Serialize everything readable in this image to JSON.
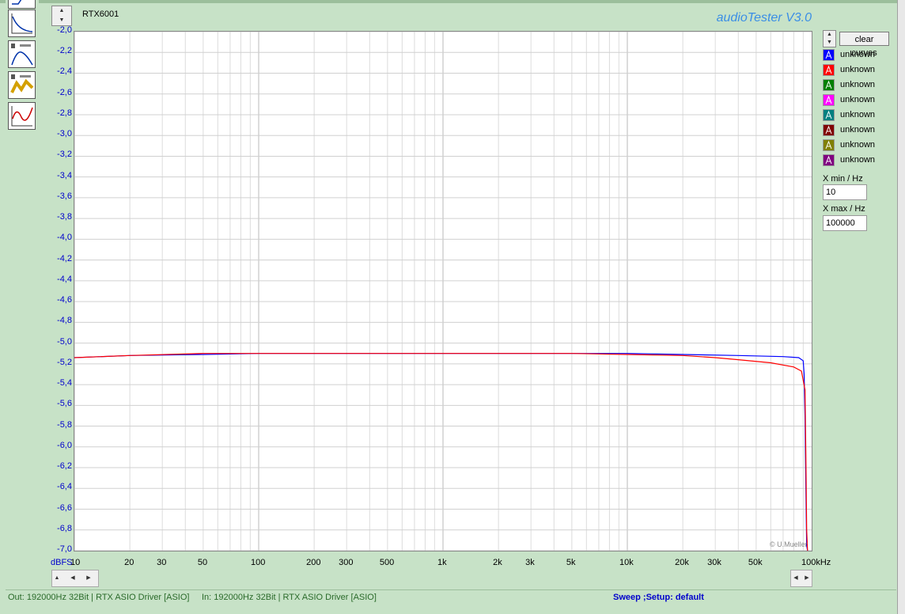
{
  "window": {
    "title": "audioTester  V3.0",
    "chart_name": "RTX6001"
  },
  "toolbar": {
    "tools": [
      "frequency-response-icon",
      "speaker-level-icon",
      "speaker-curve-icon",
      "scope-icon"
    ]
  },
  "legend": {
    "clear_label": "clear curves",
    "items": [
      {
        "label": "unknown",
        "color": "#0000ff"
      },
      {
        "label": "unknown",
        "color": "#ff0000"
      },
      {
        "label": "unknown",
        "color": "#008000"
      },
      {
        "label": "unknown",
        "color": "#ff00ff"
      },
      {
        "label": "unknown",
        "color": "#008080"
      },
      {
        "label": "unknown",
        "color": "#800000"
      },
      {
        "label": "unknown",
        "color": "#808000"
      },
      {
        "label": "unknown",
        "color": "#800080"
      }
    ]
  },
  "xrange": {
    "min_label": "X min / Hz",
    "min_value": "10",
    "max_label": "X max / Hz",
    "max_value": "100000"
  },
  "status": {
    "out": "Out: 192000Hz 32Bit  | RTX ASIO Driver [ASIO]",
    "in": "In: 192000Hz 32Bit  | RTX ASIO Driver [ASIO]",
    "mode": "Sweep ;Setup:  default"
  },
  "copyright": "© U.Mueller",
  "chart_data": {
    "type": "line",
    "title": "RTX6001",
    "ylabel": "dBFS",
    "xscale": "log",
    "xlim": [
      10,
      100000
    ],
    "ylim": [
      -7.0,
      -2.0
    ],
    "grid": true,
    "y_ticks": [
      "-2,0",
      "-2,2",
      "-2,4",
      "-2,6",
      "-2,8",
      "-3,0",
      "-3,2",
      "-3,4",
      "-3,6",
      "-3,8",
      "-4,0",
      "-4,2",
      "-4,4",
      "-4,6",
      "-4,8",
      "-5,0",
      "-5,2",
      "-5,4",
      "-5,6",
      "-5,8",
      "-6,0",
      "-6,2",
      "-6,4",
      "-6,6",
      "-6,8",
      "-7,0"
    ],
    "x_ticks": [
      {
        "v": 10,
        "label": "10"
      },
      {
        "v": 20,
        "label": "20"
      },
      {
        "v": 30,
        "label": "30"
      },
      {
        "v": 50,
        "label": "50"
      },
      {
        "v": 100,
        "label": "100"
      },
      {
        "v": 200,
        "label": "200"
      },
      {
        "v": 300,
        "label": "300"
      },
      {
        "v": 500,
        "label": "500"
      },
      {
        "v": 1000,
        "label": "1k"
      },
      {
        "v": 2000,
        "label": "2k"
      },
      {
        "v": 3000,
        "label": "3k"
      },
      {
        "v": 5000,
        "label": "5k"
      },
      {
        "v": 10000,
        "label": "10k"
      },
      {
        "v": 20000,
        "label": "20k"
      },
      {
        "v": 30000,
        "label": "30k"
      },
      {
        "v": 50000,
        "label": "50k"
      },
      {
        "v": 100000,
        "label": "100kHz"
      }
    ],
    "series": [
      {
        "color": "#0000ff",
        "x": [
          10,
          20,
          50,
          100,
          500,
          1000,
          2000,
          5000,
          10000,
          20000,
          40000,
          70000,
          85000,
          90000,
          91000,
          92000,
          93000,
          94000,
          95000
        ],
        "y": [
          -5.14,
          -5.12,
          -5.11,
          -5.1,
          -5.1,
          -5.1,
          -5.1,
          -5.1,
          -5.1,
          -5.11,
          -5.12,
          -5.13,
          -5.14,
          -5.17,
          -5.3,
          -5.7,
          -6.4,
          -6.95,
          -7.0
        ]
      },
      {
        "color": "#ff0000",
        "x": [
          10,
          20,
          50,
          100,
          500,
          1000,
          2000,
          5000,
          10000,
          20000,
          30000,
          40000,
          60000,
          80000,
          88000,
          92000,
          93000,
          94000,
          95000
        ],
        "y": [
          -5.14,
          -5.12,
          -5.1,
          -5.1,
          -5.1,
          -5.1,
          -5.1,
          -5.1,
          -5.11,
          -5.12,
          -5.14,
          -5.16,
          -5.19,
          -5.23,
          -5.27,
          -5.45,
          -6.1,
          -6.8,
          -7.0
        ]
      }
    ]
  }
}
